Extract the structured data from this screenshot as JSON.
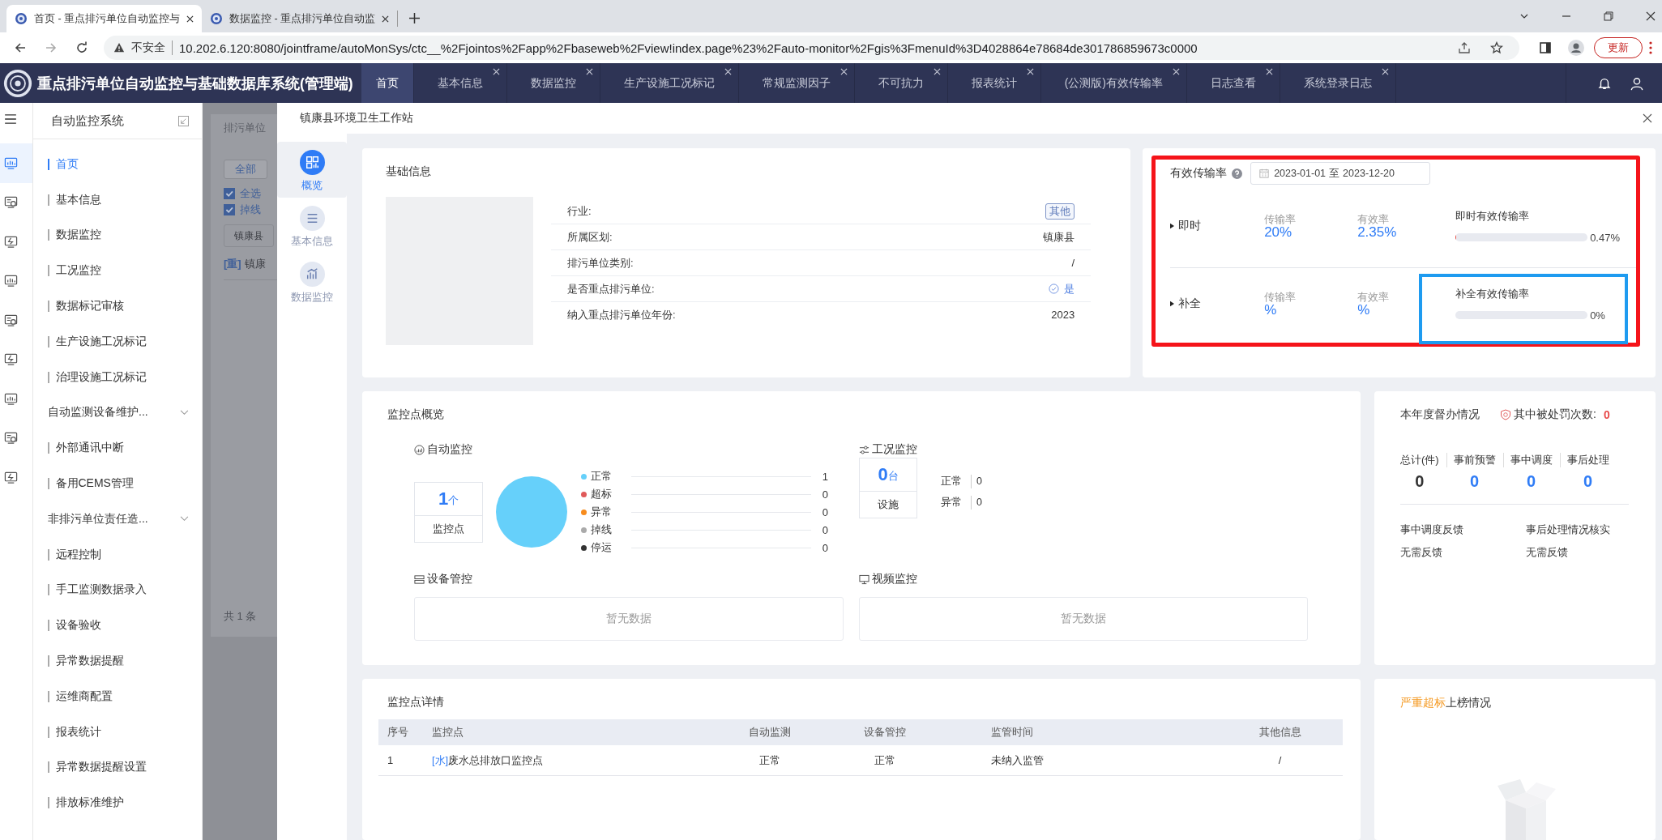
{
  "browser": {
    "tabs": [
      {
        "title": "首页 - 重点排污单位自动监控与",
        "selected": true
      },
      {
        "title": "数据监控 - 重点排污单位自动监",
        "selected": false
      }
    ],
    "security": "不安全",
    "url": "10.202.6.120:8080/jointframe/autoMonSys/ctc__%2Fjointos%2Fapp%2Fbaseweb%2Fview!index.page%23%2Fauto-monitor%2Fgis%3FmenuId%3D4028864e78684de301786859673c0000",
    "update_button": "更新"
  },
  "app": {
    "title": "重点排污单位自动监控与基础数据库系统(管理端)",
    "tabs": [
      {
        "label": "首页",
        "selected": true,
        "closable": false
      },
      {
        "label": "基本信息",
        "selected": false,
        "closable": true
      },
      {
        "label": "数据监控",
        "selected": false,
        "closable": true
      },
      {
        "label": "生产设施工况标记",
        "selected": false,
        "closable": true
      },
      {
        "label": "常规监测因子",
        "selected": false,
        "closable": true
      },
      {
        "label": "不可抗力",
        "selected": false,
        "closable": true
      },
      {
        "label": "报表统计",
        "selected": false,
        "closable": true
      },
      {
        "label": "(公测版)有效传输率",
        "selected": false,
        "closable": true
      },
      {
        "label": "日志查看",
        "selected": false,
        "closable": true
      },
      {
        "label": "系统登录日志",
        "selected": false,
        "closable": true
      }
    ]
  },
  "rail": [
    {
      "selected": true
    },
    {
      "selected": false
    },
    {
      "selected": false
    },
    {
      "selected": false
    },
    {
      "selected": false
    },
    {
      "selected": false
    },
    {
      "selected": false
    },
    {
      "selected": false
    },
    {
      "selected": false
    }
  ],
  "sidebar": {
    "title": "自动监控系统",
    "items": [
      {
        "label": "首页",
        "selected": true,
        "expandable": false
      },
      {
        "label": "基本信息",
        "selected": false,
        "expandable": false
      },
      {
        "label": "数据监控",
        "selected": false,
        "expandable": false
      },
      {
        "label": "工况监控",
        "selected": false,
        "expandable": false
      },
      {
        "label": "数据标记审核",
        "selected": false,
        "expandable": false
      },
      {
        "label": "生产设施工况标记",
        "selected": false,
        "expandable": false
      },
      {
        "label": "治理设施工况标记",
        "selected": false,
        "expandable": false
      },
      {
        "label": "自动监测设备维护...",
        "selected": false,
        "expandable": true
      },
      {
        "label": "外部通讯中断",
        "selected": false,
        "expandable": false
      },
      {
        "label": "备用CEMS管理",
        "selected": false,
        "expandable": false
      },
      {
        "label": "非排污单位责任造...",
        "selected": false,
        "expandable": true
      },
      {
        "label": "远程控制",
        "selected": false,
        "expandable": false
      },
      {
        "label": "手工监测数据录入",
        "selected": false,
        "expandable": false
      },
      {
        "label": "设备验收",
        "selected": false,
        "expandable": false
      },
      {
        "label": "异常数据提醒",
        "selected": false,
        "expandable": false
      },
      {
        "label": "运维商配置",
        "selected": false,
        "expandable": false
      },
      {
        "label": "报表统计",
        "selected": false,
        "expandable": false
      },
      {
        "label": "异常数据提醒设置",
        "selected": false,
        "expandable": false
      },
      {
        "label": "排放标准维护",
        "selected": false,
        "expandable": false
      }
    ]
  },
  "backdrop": {
    "title": "排污单位",
    "filter_button": "全部",
    "checks": [
      {
        "label": "全选",
        "checked": true
      },
      {
        "label": "掉线",
        "checked": true
      }
    ],
    "region": "镇康县",
    "row_tag": "[重]",
    "row_text": "镇康",
    "pagination": "共 1 条"
  },
  "modal": {
    "title": "镇康县环境卫生工作站",
    "nav": [
      {
        "label": "概览",
        "selected": true
      },
      {
        "label": "基本信息",
        "selected": false
      },
      {
        "label": "数据监控",
        "selected": false
      }
    ],
    "basic_info": {
      "title": "基础信息",
      "rows": [
        {
          "label": "行业:",
          "value": "其他",
          "kind": "tag"
        },
        {
          "label": "所属区划:",
          "value": "镇康县",
          "kind": "text"
        },
        {
          "label": "排污单位类别:",
          "value": "/",
          "kind": "text"
        },
        {
          "label": "是否重点排污单位:",
          "value": "是",
          "kind": "check"
        },
        {
          "label": "纳入重点排污单位年份:",
          "value": "2023",
          "kind": "text"
        }
      ]
    },
    "transmission": {
      "title": "有效传输率",
      "date_from": "2023-01-01",
      "date_sep": "至",
      "date_to": "2023-12-20",
      "rows": [
        {
          "label": "即时",
          "rate_label": "传输率",
          "rate": "20%",
          "valid_label": "有效率",
          "valid": "2.35%",
          "combined_label": "即时有效传输率",
          "level": 0.0047,
          "reading": "0.47%"
        },
        {
          "label": "补全",
          "rate_label": "传输率",
          "rate": "%",
          "valid_label": "有效率",
          "valid": "%",
          "combined_label": "补全有效传输率",
          "level": 0,
          "reading": "0%"
        }
      ]
    },
    "overview": {
      "title": "监控点概览",
      "auto": {
        "title": "自动监控",
        "count": "1",
        "unit": "个",
        "count_label": "监控点",
        "legend": [
          {
            "value": "1",
            "color": "#66d0fa"
          },
          {
            "value": "0",
            "color": "#e05a5a"
          },
          {
            "value": "0",
            "color": "#f78c1e"
          },
          {
            "value": "0",
            "color": "#aaaaaa"
          },
          {
            "value": "0",
            "color": "#333333"
          }
        ],
        "chart_data": {
          "type": "pie",
          "categories": [
            "正常",
            "超标",
            "异常",
            "掉线",
            "停运"
          ],
          "values": [
            1,
            0,
            0,
            0,
            0
          ]
        }
      },
      "condition": {
        "title": "工况监控",
        "count": "0",
        "unit": "台",
        "count_label": "设施",
        "stats": [
          {
            "label": "正常",
            "value": "0"
          },
          {
            "label": "异常",
            "value": "0"
          }
        ]
      },
      "equipment": {
        "title": "设备管控",
        "empty": "暂无数据"
      },
      "video": {
        "title": "视频监控",
        "empty": "暂无数据"
      }
    },
    "supervision": {
      "title": "本年度督办情况",
      "penalty_label": "其中被处罚次数:",
      "penalty": "0",
      "stats": [
        {
          "label": "总计(件)",
          "value": "0",
          "kind": "total"
        },
        {
          "label": "事前预警",
          "value": "0",
          "kind": "count"
        },
        {
          "label": "事中调度",
          "value": "0",
          "kind": "count"
        },
        {
          "label": "事后处理",
          "value": "0",
          "kind": "count"
        }
      ],
      "feedback": [
        {
          "label": "事中调度反馈",
          "value": "无需反馈"
        },
        {
          "label": "事后处理情况核实",
          "value": "无需反馈"
        }
      ]
    },
    "details": {
      "title": "监控点详情",
      "columns": [
        "序号",
        "监控点",
        "自动监测",
        "设备管控",
        "监管时间",
        "其他信息"
      ],
      "rows": [
        {
          "index": "1",
          "tag": "[水]",
          "name": "废水总排放口监控点",
          "auto": "正常",
          "equipment": "正常",
          "supervision": "未纳入监管",
          "other": "/"
        }
      ]
    },
    "ranking": {
      "title_highlight": "严重超标",
      "title_rest": "上榜情况"
    }
  }
}
